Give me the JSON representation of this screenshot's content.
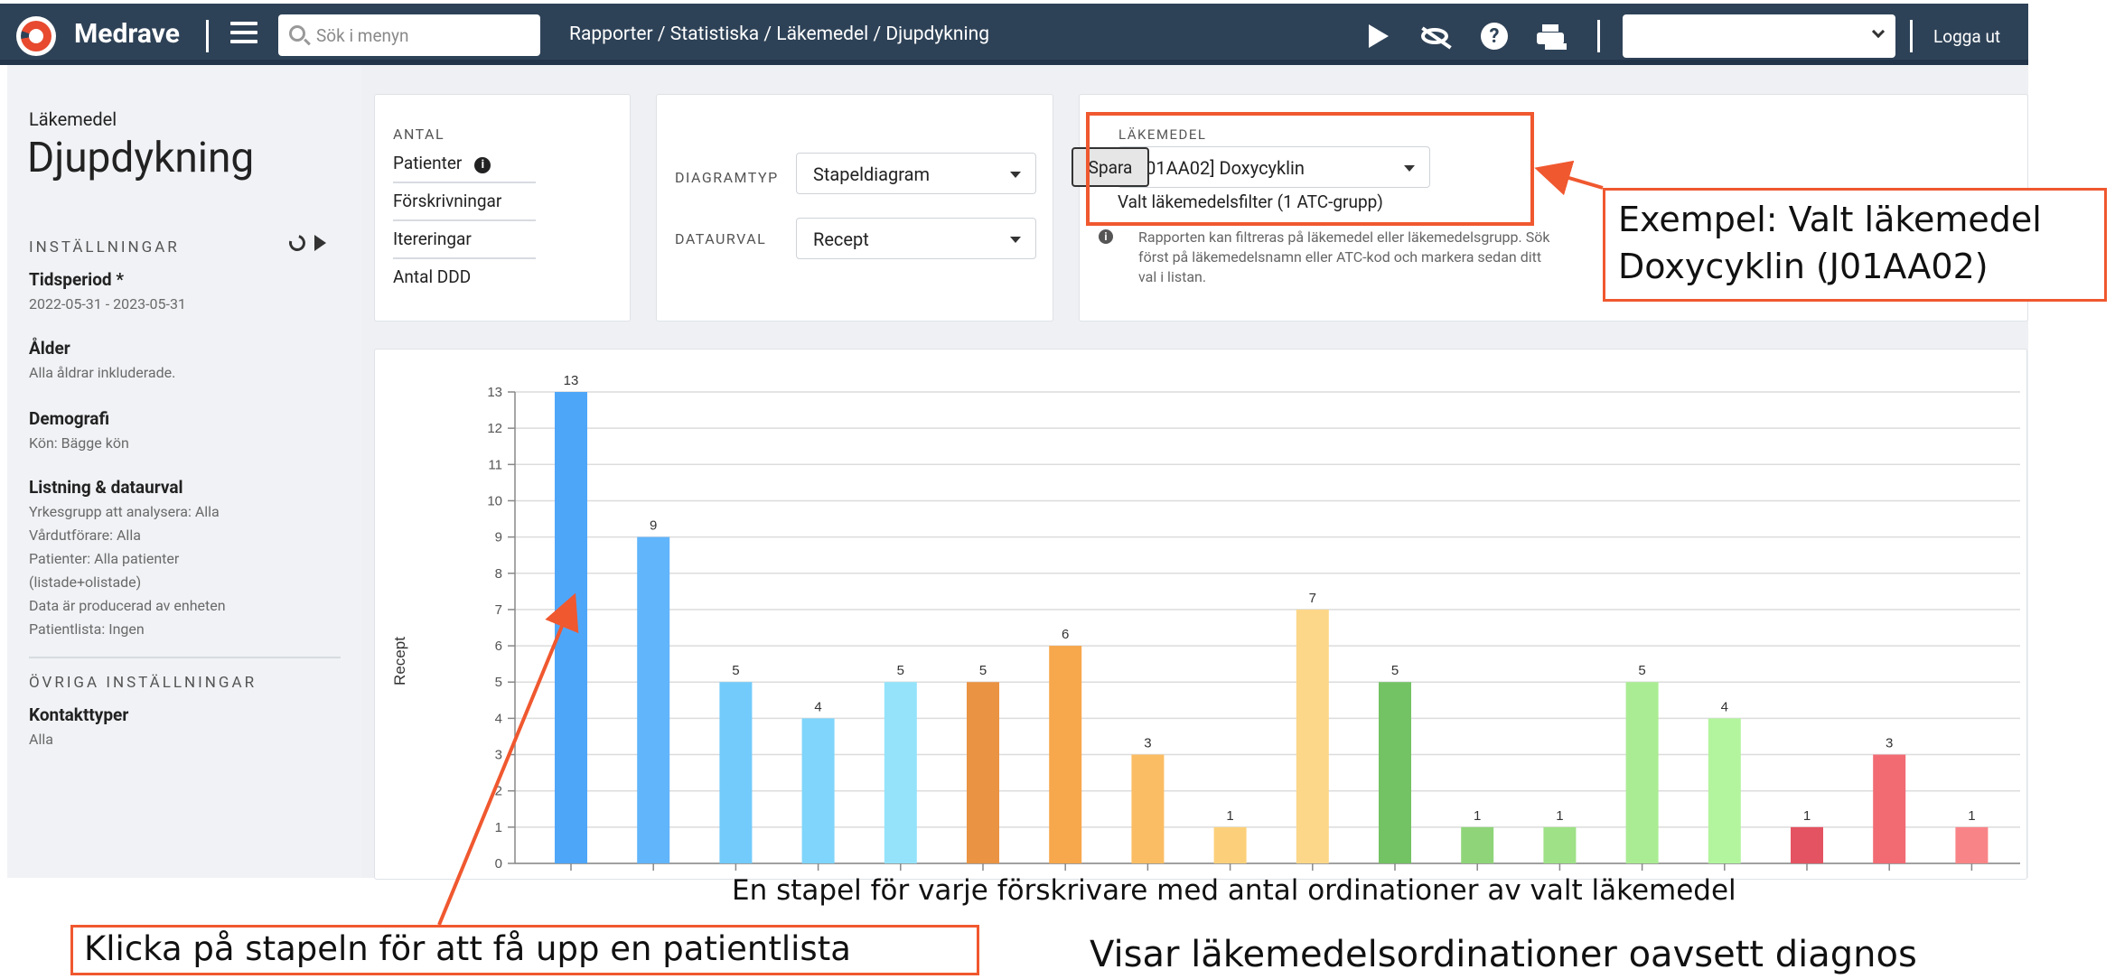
{
  "nav": {
    "brand": "Medrave",
    "search_placeholder": "Sök i menyn",
    "breadcrumb": "Rapporter / Statistiska / Läkemedel / Djupdykning",
    "select_value": "",
    "logout": "Logga ut",
    "icons": [
      "menu-icon",
      "search-icon",
      "play-icon",
      "eye-off-icon",
      "help-icon",
      "print-icon",
      "chevron-down-icon"
    ]
  },
  "sidebar": {
    "category": "Läkemedel",
    "title": "Djupdykning",
    "settings_label": "INSTÄLLNINGAR",
    "period_title": "Tidsperiod *",
    "period_value": "2022-05-31 - 2023-05-31",
    "age_title": "Ålder",
    "age_value": "Alla åldrar inkluderade.",
    "demo_title": "Demografi",
    "demo_value": "Kön: Bägge kön",
    "listing_title": "Listning & dataurval",
    "listing_lines": [
      "Yrkesgrupp att analysera: Alla",
      "Vårdutförare: Alla",
      "Patienter: Alla patienter",
      "(listade+olistade)",
      "Data är producerad av enheten",
      "Patientlista: Ingen"
    ],
    "other_label": "ÖVRIGA INSTÄLLNINGAR",
    "contact_title": "Kontakttyper",
    "contact_value": "Alla"
  },
  "antal": {
    "label": "ANTAL",
    "options": [
      "Patienter",
      "Förskrivningar",
      "Itereringar",
      "Antal DDD"
    ]
  },
  "diagram": {
    "type_label": "DIAGRAMTYP",
    "type_value": "Stapeldiagram",
    "data_label": "DATAURVAL",
    "data_value": "Recept"
  },
  "drug": {
    "label": "LÄKEMEDEL",
    "value": "[J01AA02] Doxycyklin",
    "save": "Spara",
    "filter_text": "Valt läkemedelsfilter (1 ATC-grupp)",
    "help": "Rapporten kan filtreras på läkemedel eller läkemedelsgrupp. Sök först på läkemedelsnamn eller ATC-kod och markera sedan ditt val i listan."
  },
  "annotations": {
    "drug_example_line1": "Exempel: Valt läkemedel",
    "drug_example_line2": "Doxycyklin (J01AA02)",
    "bar_caption": "En stapel för varje förskrivare med antal ordinationer av valt läkemedel",
    "click_hint": "Klicka på stapeln för att få upp en patientlista",
    "diagnosis_note": "Visar läkemedelsordinationer oavsett diagnos",
    "accent": "#f0582f"
  },
  "chart_data": {
    "type": "bar",
    "ylabel": "Recept",
    "ylim": [
      0,
      13
    ],
    "yticks": [
      0,
      1,
      2,
      3,
      4,
      5,
      6,
      7,
      8,
      9,
      10,
      11,
      12,
      13
    ],
    "values": [
      13,
      9,
      5,
      4,
      5,
      5,
      6,
      3,
      1,
      7,
      5,
      1,
      1,
      5,
      4,
      1,
      3,
      1
    ],
    "colors": [
      "#4ea6f9",
      "#61b5fb",
      "#72cbfb",
      "#7fd5fb",
      "#94e3fb",
      "#ea9342",
      "#f7a74c",
      "#fbbd63",
      "#fcd07a",
      "#fcd789",
      "#73c264",
      "#8fd479",
      "#9ee186",
      "#aaec93",
      "#b3f49e",
      "#e45361",
      "#f26b73",
      "#f98487"
    ],
    "grid": true
  }
}
